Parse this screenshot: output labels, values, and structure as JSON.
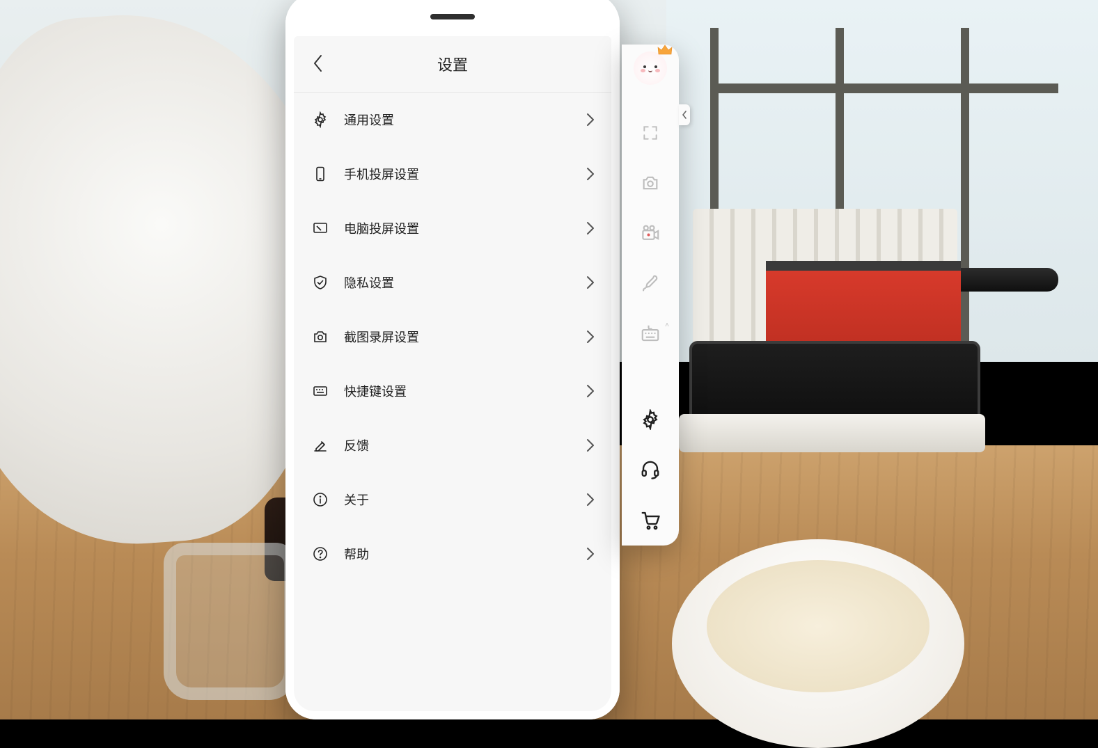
{
  "header": {
    "title": "设置"
  },
  "menu": {
    "items": [
      {
        "label": "通用设置",
        "icon": "gear"
      },
      {
        "label": "手机投屏设置",
        "icon": "phone"
      },
      {
        "label": "电脑投屏设置",
        "icon": "monitor"
      },
      {
        "label": "隐私设置",
        "icon": "shield"
      },
      {
        "label": "截图录屏设置",
        "icon": "camera"
      },
      {
        "label": "快捷键设置",
        "icon": "keyboard"
      },
      {
        "label": "反馈",
        "icon": "edit"
      },
      {
        "label": "关于",
        "icon": "info"
      },
      {
        "label": "帮助",
        "icon": "help"
      }
    ]
  },
  "sidebar": {
    "items": [
      {
        "name": "avatar"
      },
      {
        "name": "fullscreen"
      },
      {
        "name": "camera"
      },
      {
        "name": "record"
      },
      {
        "name": "draw"
      },
      {
        "name": "keyboard"
      },
      {
        "name": "settings",
        "active": true
      },
      {
        "name": "support",
        "active": true
      },
      {
        "name": "cart",
        "active": true
      }
    ]
  }
}
